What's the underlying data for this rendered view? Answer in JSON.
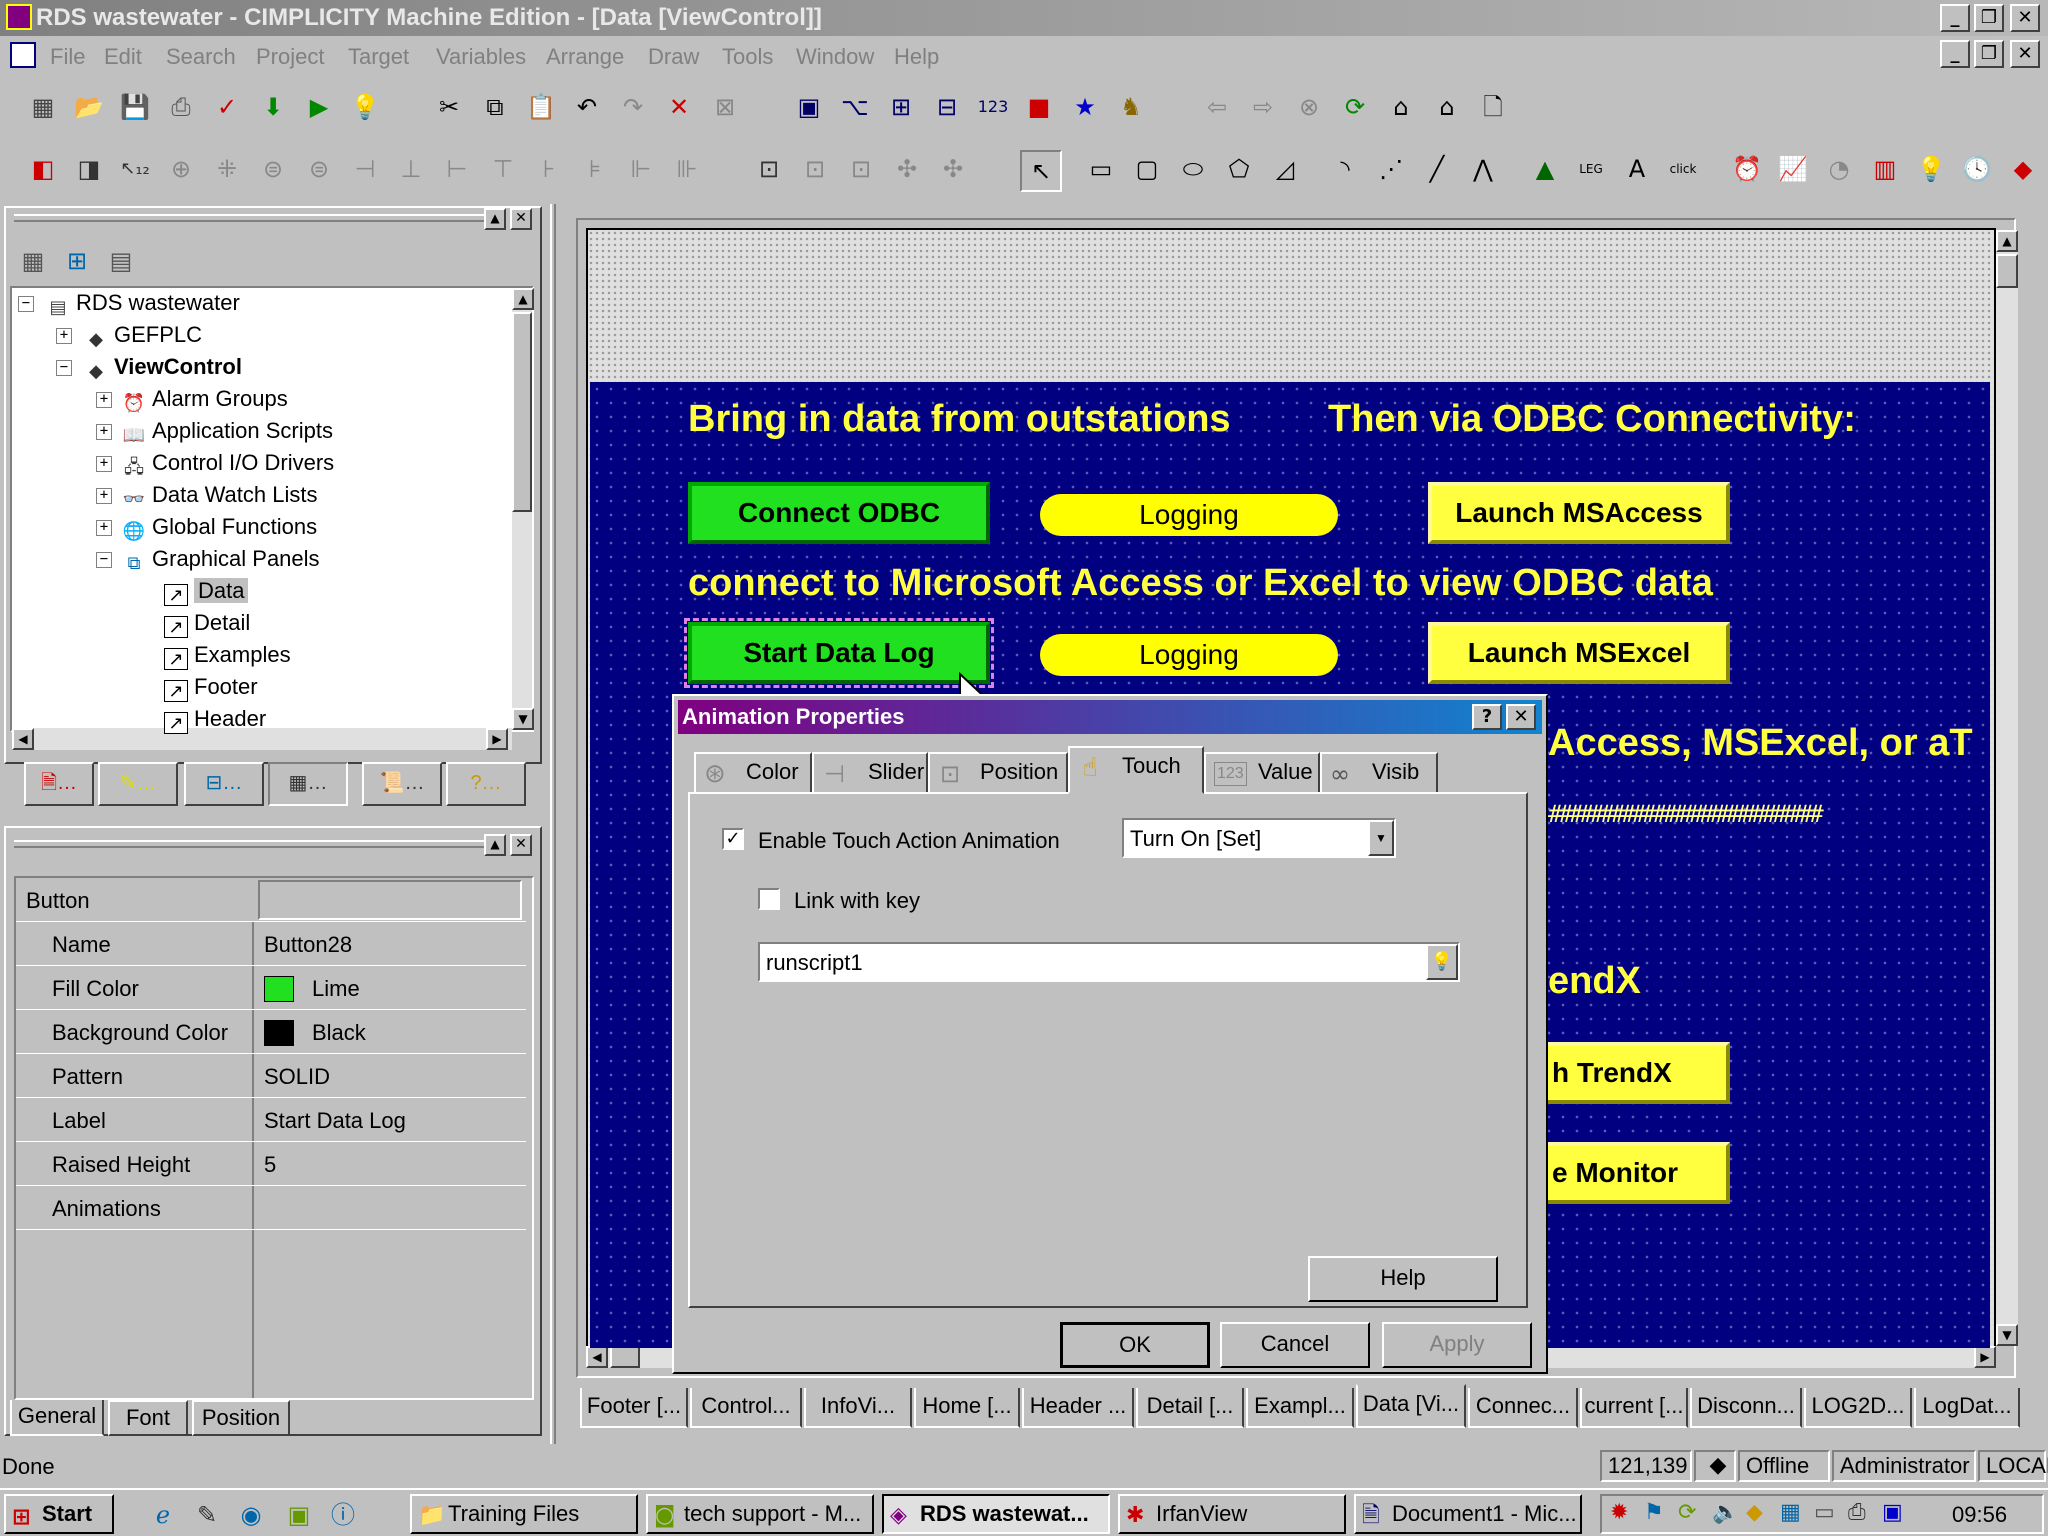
{
  "window": {
    "title": "RDS wastewater - CIMPLICITY Machine Edition - [Data [ViewControl]]",
    "controls": [
      "_",
      "❐",
      "✕"
    ]
  },
  "menu": [
    "File",
    "Edit",
    "Search",
    "Project",
    "Target",
    "Variables",
    "Arrange",
    "Draw",
    "Tools",
    "Window",
    "Help"
  ],
  "tree": {
    "items": [
      {
        "label": "RDS wastewater",
        "icon": "project-icon",
        "bold": false
      },
      {
        "label": "GEFPLC",
        "icon": "target-icon",
        "bold": false
      },
      {
        "label": "ViewControl",
        "icon": "target-icon",
        "bold": true
      },
      {
        "label": "Alarm Groups",
        "icon": "alarm-icon",
        "bold": false
      },
      {
        "label": "Application Scripts",
        "icon": "script-icon",
        "bold": false
      },
      {
        "label": "Control I/O Drivers",
        "icon": "driver-icon",
        "bold": false
      },
      {
        "label": "Data Watch Lists",
        "icon": "watch-icon",
        "bold": false
      },
      {
        "label": "Global Functions",
        "icon": "globe-icon",
        "bold": false
      },
      {
        "label": "Graphical Panels",
        "icon": "panels-icon",
        "bold": false
      },
      {
        "label": "Data",
        "icon": "panel-icon",
        "bold": false
      },
      {
        "label": "Detail",
        "icon": "panel-icon",
        "bold": false
      },
      {
        "label": "Examples",
        "icon": "panel-icon",
        "bold": false
      },
      {
        "label": "Footer",
        "icon": "panel-icon",
        "bold": false
      },
      {
        "label": "Header",
        "icon": "panel-icon",
        "bold": false
      }
    ]
  },
  "inspector": {
    "header": "Button",
    "rows": [
      {
        "label": "Name",
        "value": "Button28"
      },
      {
        "label": "Fill Color",
        "value": "Lime",
        "swatch": "#20e020"
      },
      {
        "label": "Background Color",
        "value": "Black",
        "swatch": "#000000"
      },
      {
        "label": "Pattern",
        "value": "SOLID"
      },
      {
        "label": "Label",
        "value": "Start Data Log"
      },
      {
        "label": "Raised Height",
        "value": "5"
      },
      {
        "label": "Animations",
        "value": ""
      }
    ],
    "tabs": [
      "General",
      "Font",
      "Position"
    ]
  },
  "panel": {
    "heading1": "Bring in data from outstations",
    "heading2": "Then via ODBC Connectivity:",
    "connect_odbc": "Connect ODBC",
    "logging": "Logging",
    "launch_msaccess": "Launch MSAccess",
    "heading3": "connect to Microsoft Access or Excel to view ODBC data",
    "start_data_log": "Start Data Log",
    "launch_msexcel": "Launch MSExcel",
    "partial_text": "Access, MSExcel, or aT",
    "hash_text": "##########################",
    "trendx_text": "endX",
    "trendx_button": "h TrendX",
    "monitor_button": "e Monitor"
  },
  "dialog": {
    "title": "Animation Properties",
    "tabs": [
      "Color",
      "Slider",
      "Position",
      "Touch",
      "Value",
      "Visib"
    ],
    "enable_touch": "Enable Touch Action Animation",
    "action_value": "Turn On [Set]",
    "link_key": "Link with key",
    "script_value": "runscript1",
    "help": "Help",
    "ok": "OK",
    "cancel": "Cancel",
    "apply": "Apply"
  },
  "doc_tabs": [
    "Footer [...",
    "Control...",
    "InfoVi...",
    "Home [...",
    "Header ...",
    "Detail [...",
    "Exampl...",
    "Data [Vi...",
    "Connec...",
    "current [...",
    "Disconn...",
    "LOG2D...",
    "LogDat..."
  ],
  "status": {
    "text": "Done",
    "coords": "121,139",
    "mode": "Offline",
    "user": "Administrator",
    "location": "LOCAL"
  },
  "taskbar": {
    "start": "Start",
    "tasks": [
      "Training Files",
      "tech support - M...",
      "RDS wastewat...",
      "IrfanView",
      "Document1 - Mic..."
    ],
    "clock": "09:56"
  }
}
